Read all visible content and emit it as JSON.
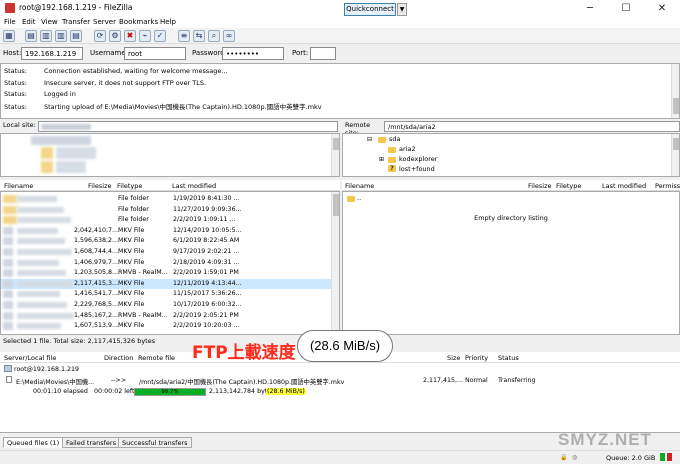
{
  "window": {
    "title": "root@192.168.1.219 - FileZilla"
  },
  "menu": [
    "File",
    "Edit",
    "View",
    "Transfer",
    "Server",
    "Bookmarks",
    "Help"
  ],
  "quickconnect": {
    "host_label": "Host:",
    "host_value": "192.168.1.219",
    "username_label": "Username:",
    "username_value": "root",
    "password_label": "Password:",
    "password_value": "••••••••",
    "port_label": "Port:",
    "port_value": "",
    "button_label": "Quickconnect"
  },
  "log": [
    {
      "k": "Status:",
      "v": "Connection established, waiting for welcome message..."
    },
    {
      "k": "Status:",
      "v": "Insecure server, it does not support FTP over TLS."
    },
    {
      "k": "Status:",
      "v": "Logged in"
    },
    {
      "k": "Status:",
      "v": "Starting upload of E:\\Media\\Movies\\中国機長(The Captain).HD.1080p.國語中英雙字.mkv"
    }
  ],
  "local": {
    "site_label": "Local site:",
    "columns": [
      "Filename",
      "Filesize",
      "Filetype",
      "Last modified"
    ],
    "files": [
      {
        "size": "",
        "type": "File folder",
        "date": "1/19/2019 8:41:30 ..."
      },
      {
        "size": "",
        "type": "File folder",
        "date": "11/27/2019 9:09:36..."
      },
      {
        "size": "",
        "type": "File folder",
        "date": "2/2/2019 1:09:11 ..."
      },
      {
        "size": "2,042,410,7...",
        "type": "MKV File",
        "date": "12/14/2019 10:05:5..."
      },
      {
        "size": "1,596,638,2...",
        "type": "MKV File",
        "date": "6/1/2019 8:22:45 AM"
      },
      {
        "size": "1,608,744,4...",
        "type": "MKV File",
        "date": "9/17/2019 2:02:21 ..."
      },
      {
        "size": "1,406,979,7...",
        "type": "MKV File",
        "date": "2/18/2019 4:09:31 ..."
      },
      {
        "size": "1,203,505,8...",
        "type": "RMVB - RealM...",
        "date": "2/2/2019 1:59:01 PM"
      },
      {
        "size": "2,117,415,3...",
        "type": "MKV File",
        "date": "12/11/2019 4:13:44..."
      },
      {
        "size": "1,416,541,7...",
        "type": "MKV File",
        "date": "11/15/2017 5:36:26..."
      },
      {
        "size": "2,229,768,5...",
        "type": "MKV File",
        "date": "10/17/2019 6:00:32..."
      },
      {
        "size": "1,485,167,2...",
        "type": "RMVB - RealM...",
        "date": "2/2/2019 2:05:21 PM"
      },
      {
        "size": "1,607,513,9...",
        "type": "MKV File",
        "date": "2/2/2019 10:20:03 ..."
      }
    ],
    "status": "Selected 1 file. Total size: 2,117,415,326 bytes"
  },
  "remote": {
    "site_label": "Remote site:",
    "site_value": "/mnt/sda/aria2",
    "tree": [
      "sda",
      "aria2",
      "kodexplorer",
      "lost+found"
    ],
    "columns": [
      "Filename",
      "Filesize",
      "Filetype",
      "Last modified",
      "Permiss"
    ],
    "parent": "..",
    "empty": "Empty directory listing"
  },
  "queue": {
    "columns": [
      "Server/Local file",
      "Direction",
      "Remote file",
      "Size",
      "Priority",
      "Status"
    ],
    "server": "root@192.168.1.219",
    "local_file": "E:\\Media\\Movies\\中国機...",
    "direction": "-->>",
    "remote_file": "/mnt/sda/aria2/中国機長(The Captain).HD.1080p.國語中英雙字.mkv",
    "size": "2,117,415,...",
    "priority": "Normal",
    "status": "Transferring",
    "elapsed": "00:01:10 elapsed",
    "left": "00:00:02 left",
    "progress_pct": 99.7,
    "progress_label": "99.7%",
    "bytes": "2,113,142,784 bytes",
    "speed": "(28.6 MiB/s)"
  },
  "tabs": [
    "Queued files (1)",
    "Failed transfers",
    "Successful transfers"
  ],
  "statusbar": {
    "queue": "Queue: 2.0 GiB"
  },
  "annotation": {
    "title": "FTP上載速度",
    "bubble": "(28.6 MiB/s)"
  },
  "watermark": "SMYZ.NET",
  "colors": {
    "progress": "#06b025",
    "highlight": "#ffff40",
    "annotation": "#ff2a1a"
  }
}
